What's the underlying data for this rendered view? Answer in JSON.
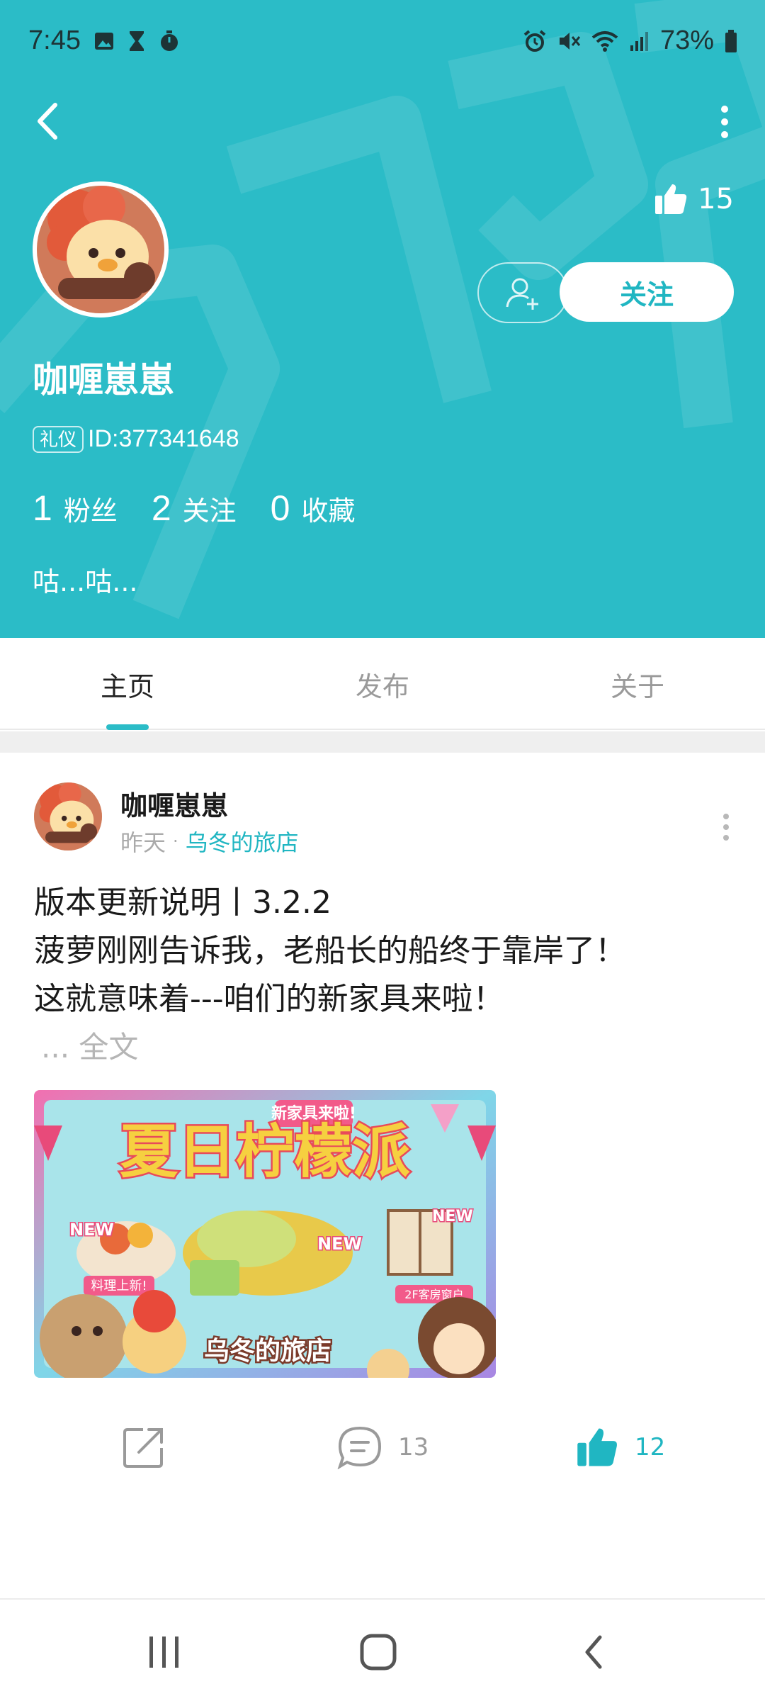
{
  "status_bar": {
    "time": "7:45",
    "battery_text": "73%",
    "left_icons": [
      "gallery-icon",
      "hourglass-icon",
      "timer-icon"
    ],
    "right_icons": [
      "alarm-icon",
      "mute-icon",
      "wifi-icon",
      "signal-icon",
      "battery-icon"
    ]
  },
  "header": {
    "like_count": "15",
    "follow_label": "关注",
    "username": "咖喱崽崽",
    "role_badge": "礼仪",
    "user_id": "ID:377341648",
    "stats": [
      {
        "num": "1",
        "label": "粉丝"
      },
      {
        "num": "2",
        "label": "关注"
      },
      {
        "num": "0",
        "label": "收藏"
      }
    ],
    "bio": "咕...咕...",
    "background_color": "#2bbcc7"
  },
  "tabs": [
    {
      "label": "主页",
      "active": true
    },
    {
      "label": "发布",
      "active": false
    },
    {
      "label": "关于",
      "active": false
    }
  ],
  "post": {
    "author": "咖喱崽崽",
    "time": "昨天",
    "separator": "·",
    "group": "乌冬的旅店",
    "lines": [
      "版本更新说明丨3.2.2",
      "菠萝刚刚告诉我，老船长的船终于靠岸了！",
      "这就意味着---咱们的新家具来啦！"
    ],
    "read_more": "... 全文",
    "image": {
      "top_banner": "新家具来啦!",
      "title": "夏日柠檬派",
      "badge_new": "NEW",
      "tag_food": "料理上新!",
      "tag_room": "2F客房窗户",
      "logo": "乌冬的旅店"
    },
    "comment_count": "13",
    "like_count": "12"
  },
  "colors": {
    "accent": "#2bbcc7",
    "accent_text": "#20b6c2"
  }
}
